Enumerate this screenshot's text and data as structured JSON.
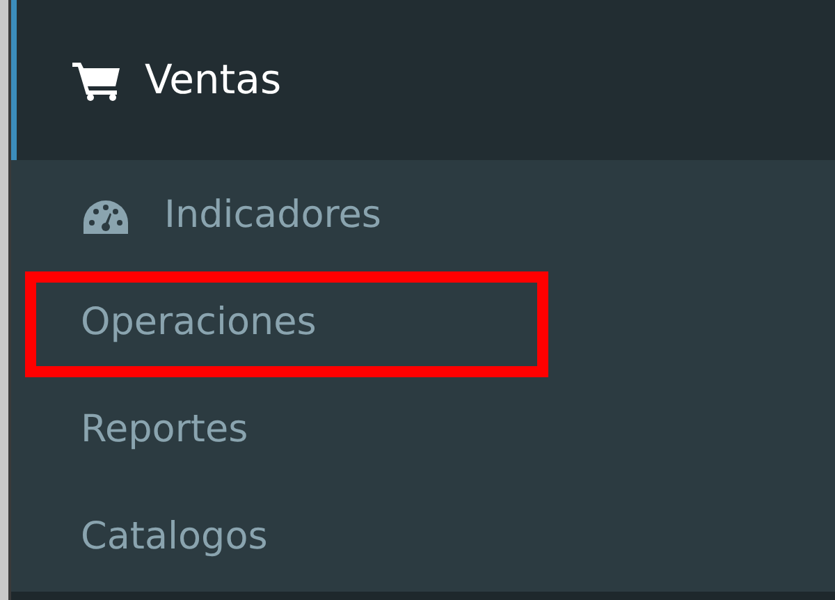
{
  "menu": {
    "label": "Ventas",
    "active": true,
    "expanded": true,
    "children": [
      {
        "label": "Indicadores",
        "kind": "with_icon",
        "highlighted": false
      },
      {
        "label": "Operaciones",
        "highlighted": true
      },
      {
        "label": "Reportes",
        "highlighted": false
      },
      {
        "label": "Catalogos",
        "highlighted": false
      }
    ]
  }
}
